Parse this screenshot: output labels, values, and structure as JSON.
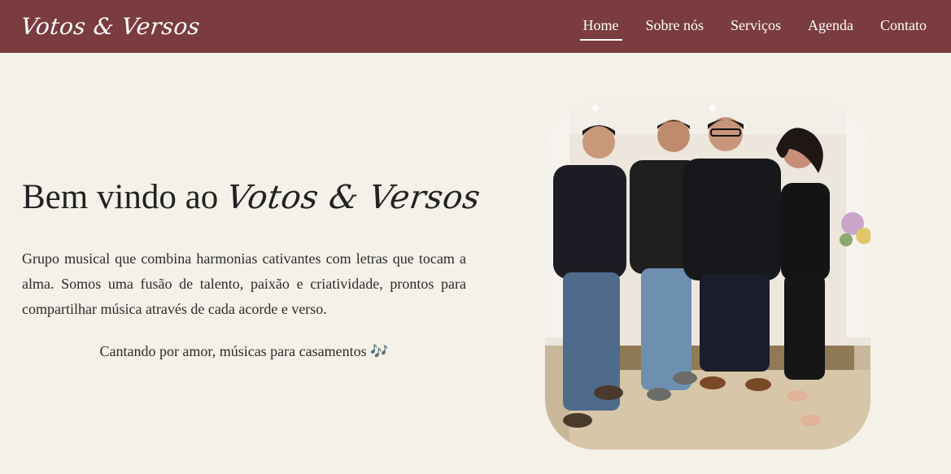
{
  "header": {
    "logo": "Votos & Versos",
    "nav": [
      {
        "label": "Home",
        "active": true
      },
      {
        "label": "Sobre nós",
        "active": false
      },
      {
        "label": "Serviços",
        "active": false
      },
      {
        "label": "Agenda",
        "active": false
      },
      {
        "label": "Contato",
        "active": false
      }
    ]
  },
  "hero": {
    "title_prefix": "Bem vindo ao",
    "title_brand": "Votos & Versos",
    "description": "Grupo musical que combina harmonias cativantes com letras que tocam a alma. Somos uma fusão de talento, paixão e criatividade, prontos para compartilhar música através de cada acorde e verso.",
    "tagline": "Cantando por amor, músicas para casamentos 🎶"
  },
  "colors": {
    "header_bg": "#7a3c3e",
    "page_bg": "#f4f1e8",
    "text": "#2b2b2b"
  }
}
